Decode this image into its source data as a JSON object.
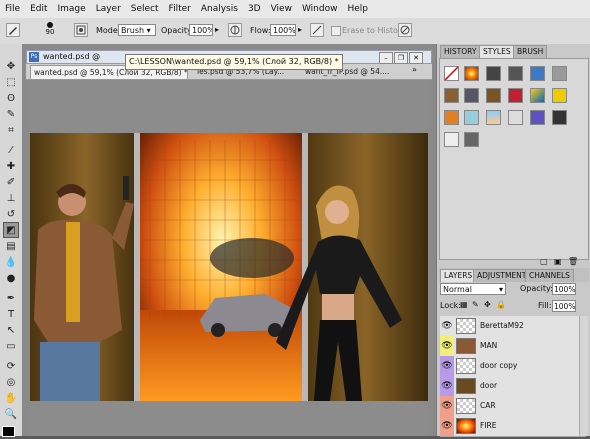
{
  "menu": [
    "File",
    "Edit",
    "Image",
    "Layer",
    "Select",
    "Filter",
    "Analysis",
    "3D",
    "View",
    "Window",
    "Help"
  ],
  "options": {
    "brush_size": "90",
    "mode_label": "Mode:",
    "mode_value": "Brush",
    "opacity_label": "Opacity:",
    "opacity_value": "100%",
    "flow_label": "Flow:",
    "flow_value": "100%",
    "erase_history": "Erase to History"
  },
  "document": {
    "window_title": "wanted.psd @",
    "tooltip": "C:\\LESSON\\wanted.psd @ 59,1% (Слой 32, RGB/8) *",
    "tabs": [
      {
        "label": "wanted.psd @ 59,1% (Слой 32, RGB/8) *"
      },
      {
        "label": "les.psd @ 53,7% (Lay..."
      },
      {
        "label": "want_fr_IP.psd @ 54...."
      }
    ]
  },
  "styles_panel": {
    "tabs": [
      "HISTORY",
      "STYLES",
      "BRUSH"
    ],
    "active": "STYLES"
  },
  "layers_panel": {
    "tabs": [
      "LAYERS",
      "ADJUSTMENT",
      "CHANNELS"
    ],
    "blend_mode": "Normal",
    "opacity_label": "Opacity:",
    "opacity_value": "100%",
    "lock_label": "Lock:",
    "fill_label": "Fill:",
    "fill_value": "100%",
    "layers": [
      {
        "name": "BerettaM92",
        "color": "#e2e2e2"
      },
      {
        "name": "MAN",
        "color": "#f0f07a"
      },
      {
        "name": "door copy",
        "color": "#b79be8"
      },
      {
        "name": "door",
        "color": "#b79be8"
      },
      {
        "name": "CAR",
        "color": "#f0a08a"
      },
      {
        "name": "FIRE",
        "color": "#f0a08a"
      }
    ]
  },
  "colors": {
    "accent": "#ffe8a0",
    "selection": "#9a9a9a"
  }
}
